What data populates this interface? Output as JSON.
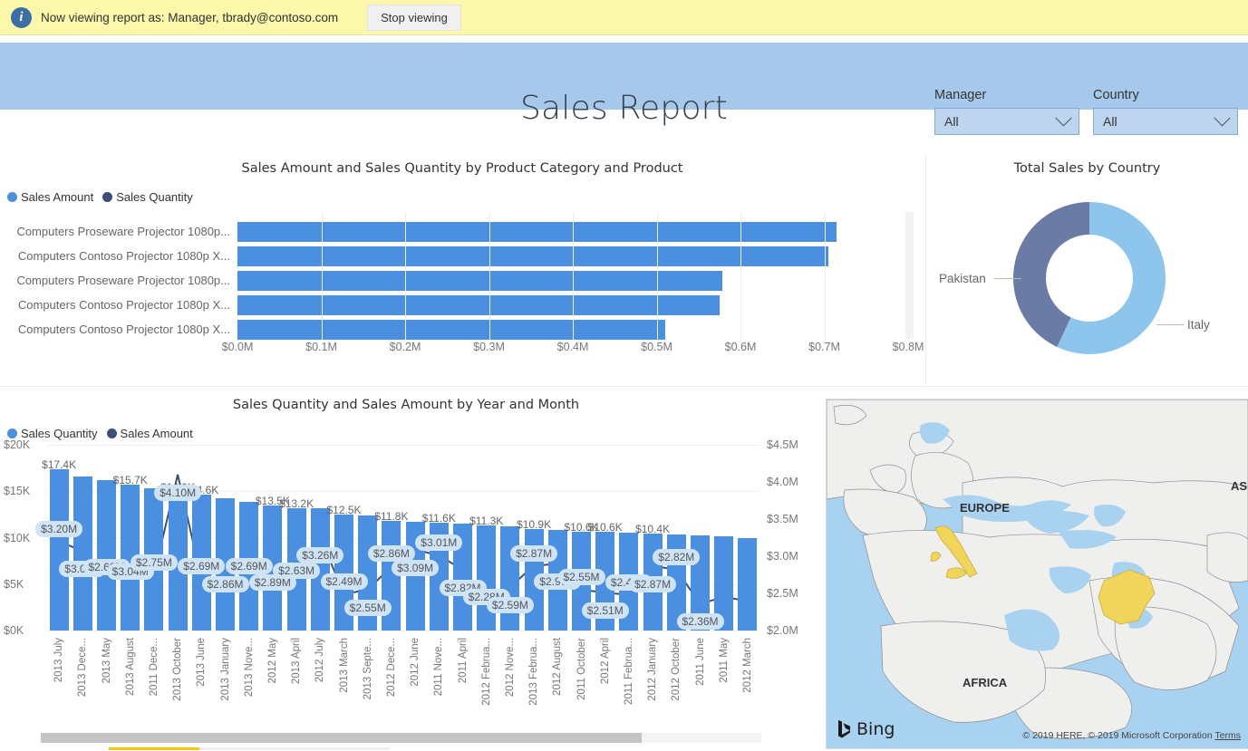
{
  "banner": {
    "icon": "info-icon",
    "message": "Now viewing report as: Manager, tbrady@contoso.com",
    "stop_button": "Stop viewing"
  },
  "header": {
    "title": "Sales Report",
    "background_color": "#a6c8ea",
    "slicers": [
      {
        "label": "Manager",
        "value": "All",
        "icon": "chevron-down-icon"
      },
      {
        "label": "Country",
        "value": "All",
        "icon": "chevron-down-icon"
      }
    ]
  },
  "colors": {
    "series_primary": "#4a8fe0",
    "series_secondary": "#3d4f78",
    "donut_italy": "#8ec5ec",
    "donut_pakistan": "#6a7ba5",
    "label_pill": "#cfe3f7",
    "map_highlight": "#f0d55a"
  },
  "chart_data": [
    {
      "id": "bar-chart",
      "type": "bar",
      "orientation": "horizontal",
      "title": "Sales Amount and Sales Quantity by Product Category and Product",
      "legend": [
        "Sales Amount",
        "Sales Quantity"
      ],
      "legend_position": "top-left",
      "xlabel": "",
      "ylabel": "",
      "categories": [
        "Computers Proseware Projector 1080p...",
        "Computers Contoso Projector 1080p X...",
        "Computers Proseware Projector 1080p...",
        "Computers Contoso Projector 1080p X...",
        "Computers Contoso Projector 1080p X..."
      ],
      "values": [
        0.715,
        0.705,
        0.578,
        0.575,
        0.51
      ],
      "value_unit": "millions USD",
      "xticks": [
        "$0.0M",
        "$0.1M",
        "$0.2M",
        "$0.3M",
        "$0.4M",
        "$0.5M",
        "$0.6M",
        "$0.7M",
        "$0.8M"
      ],
      "xlim": [
        0,
        0.8
      ],
      "grid": true
    },
    {
      "id": "donut-chart",
      "type": "pie",
      "title": "Total Sales by Country",
      "labels": [
        "Italy",
        "Pakistan"
      ],
      "values": [
        57,
        43
      ],
      "value_unit": "percent",
      "colors": [
        "#8ec5ec",
        "#6a7ba5"
      ],
      "legend_position": "callout-labels"
    },
    {
      "id": "combo-chart",
      "type": "bar",
      "title": "Sales Quantity and Sales Amount by Year and Month",
      "legend": [
        "Sales Quantity",
        "Sales Amount"
      ],
      "legend_position": "top-left",
      "ylabel": "",
      "y2label": "",
      "yticks": [
        "$0K",
        "$5K",
        "$10K",
        "$15K",
        "$20K"
      ],
      "ylim": [
        0,
        20
      ],
      "y2ticks": [
        "$2.0M",
        "$2.5M",
        "$3.0M",
        "$3.5M",
        "$4.0M",
        "$4.5M"
      ],
      "y2lim": [
        2.0,
        4.5
      ],
      "grid": true,
      "categories": [
        "2013 July",
        "2013 Dece...",
        "2013 May",
        "2013 August",
        "2011 Dece...",
        "2013 October",
        "2013 June",
        "2013 January",
        "2013 Nove...",
        "2012 May",
        "2013 April",
        "2012 July",
        "2013 March",
        "2013 Septe...",
        "2012 Dece...",
        "2012 June",
        "2011 Nove...",
        "2011 April",
        "2012 Februa...",
        "2012 Nove...",
        "2013 Februa...",
        "2012 August",
        "2011 October",
        "2012 April",
        "2011 Februa...",
        "2012 January",
        "2012 October",
        "2011 June",
        "2011 May",
        "2012 March"
      ],
      "series": [
        {
          "name": "Sales Quantity",
          "axis": "left",
          "unit": "thousands",
          "values": [
            17.4,
            16.6,
            16.2,
            15.7,
            15.3,
            14.9,
            14.6,
            14.2,
            13.9,
            13.5,
            13.2,
            13.2,
            12.5,
            12.4,
            11.8,
            11.7,
            11.6,
            11.5,
            11.3,
            11.2,
            10.9,
            10.8,
            10.6,
            10.6,
            10.5,
            10.4,
            10.3,
            10.2,
            10.1,
            10.0
          ],
          "labels": [
            "$17.4K",
            "",
            "",
            "$15.7K",
            "",
            "$14.9K",
            "$14.6K",
            "",
            "",
            "$13.5K",
            "$13.2K",
            "",
            "$12.5K",
            "",
            "$11.8K",
            "",
            "$11.6K",
            "",
            "$11.3K",
            "",
            "$10.9K",
            "",
            "$10.6K",
            "$10.6K",
            "",
            "$10.4K",
            "",
            "",
            "",
            ""
          ]
        },
        {
          "name": "Sales Amount",
          "axis": "right",
          "unit": "millions",
          "values": [
            3.2,
            3.07,
            2.68,
            3.04,
            2.75,
            4.1,
            2.69,
            2.86,
            2.69,
            2.89,
            2.63,
            3.26,
            2.49,
            2.55,
            2.86,
            3.09,
            3.01,
            2.82,
            2.28,
            2.59,
            2.87,
            2.9,
            2.55,
            2.51,
            2.48,
            2.87,
            2.82,
            2.36,
            2.45,
            2.4
          ],
          "labels": [
            "$3.20M",
            "$3.07M",
            "$2.68M",
            "$3.04M",
            "$2.75M",
            "$4.10M",
            "$2.69M",
            "$2.86M",
            "$2.69M",
            "$2.89M",
            "$2.63M",
            "$3.26M",
            "$2.49M",
            "$2.55M",
            "$2.86M",
            "$3.09M",
            "$3.01M",
            "$2.82M",
            "$2.28M",
            "$2.59M",
            "$2.87M",
            "$2.90M",
            "$2.55M",
            "$2.51M",
            "$2.48M",
            "$2.87M",
            "$2.82M",
            "$2.36M",
            "",
            ""
          ]
        }
      ]
    }
  ],
  "map": {
    "continent_labels": [
      "EUROPE",
      "AFRICA",
      "AS"
    ],
    "provider": "Bing",
    "attribution": "© 2019 HERE, © 2019 Microsoft Corporation",
    "terms_link": "Terms",
    "highlighted_countries": [
      "Italy",
      "Pakistan"
    ]
  }
}
